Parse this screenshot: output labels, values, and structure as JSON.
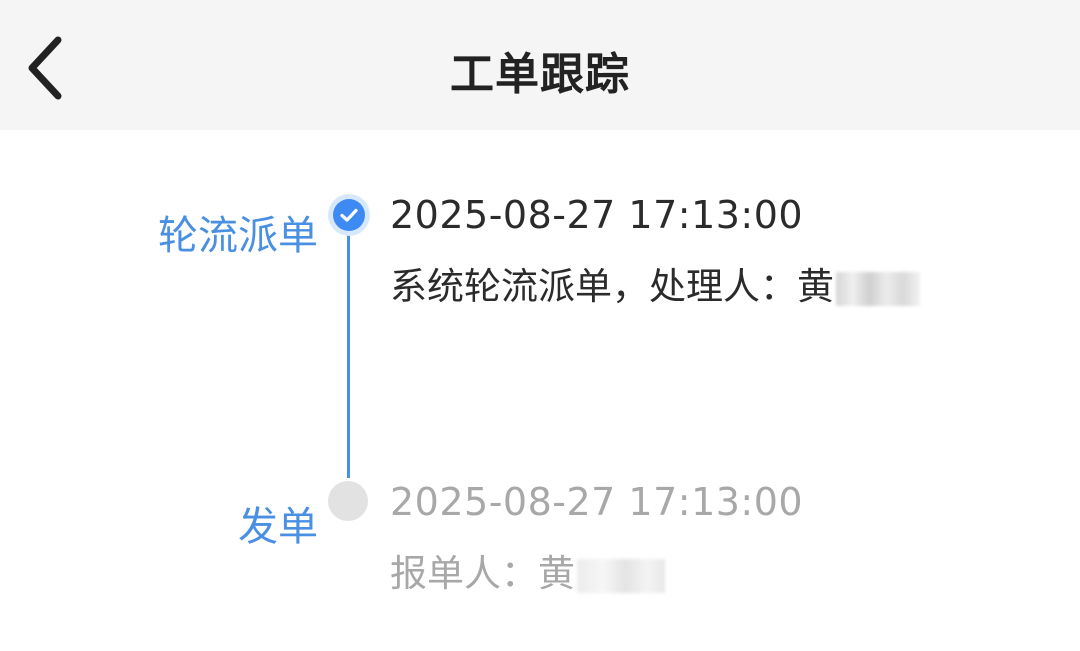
{
  "header": {
    "title": "工单跟踪",
    "back_icon": "chevron-left-icon"
  },
  "timeline": [
    {
      "label": "轮流派单",
      "status": "completed",
      "time": "2025-08-27 17:13:00",
      "desc_prefix": "系统轮流派单，处理人：黄",
      "desc_redacted": "",
      "icon": "check-circle-icon"
    },
    {
      "label": "发单",
      "status": "pending",
      "time": "2025-08-27 17:13:00",
      "desc_prefix": "报单人：黄",
      "desc_redacted": "",
      "icon": "gray-dot-icon"
    }
  ],
  "colors": {
    "accent": "#4a90e2",
    "check_fill": "#3d8bf2",
    "text_active": "#2b2b2b",
    "text_inactive": "#a8a8a8",
    "header_bg": "#f5f5f5"
  }
}
